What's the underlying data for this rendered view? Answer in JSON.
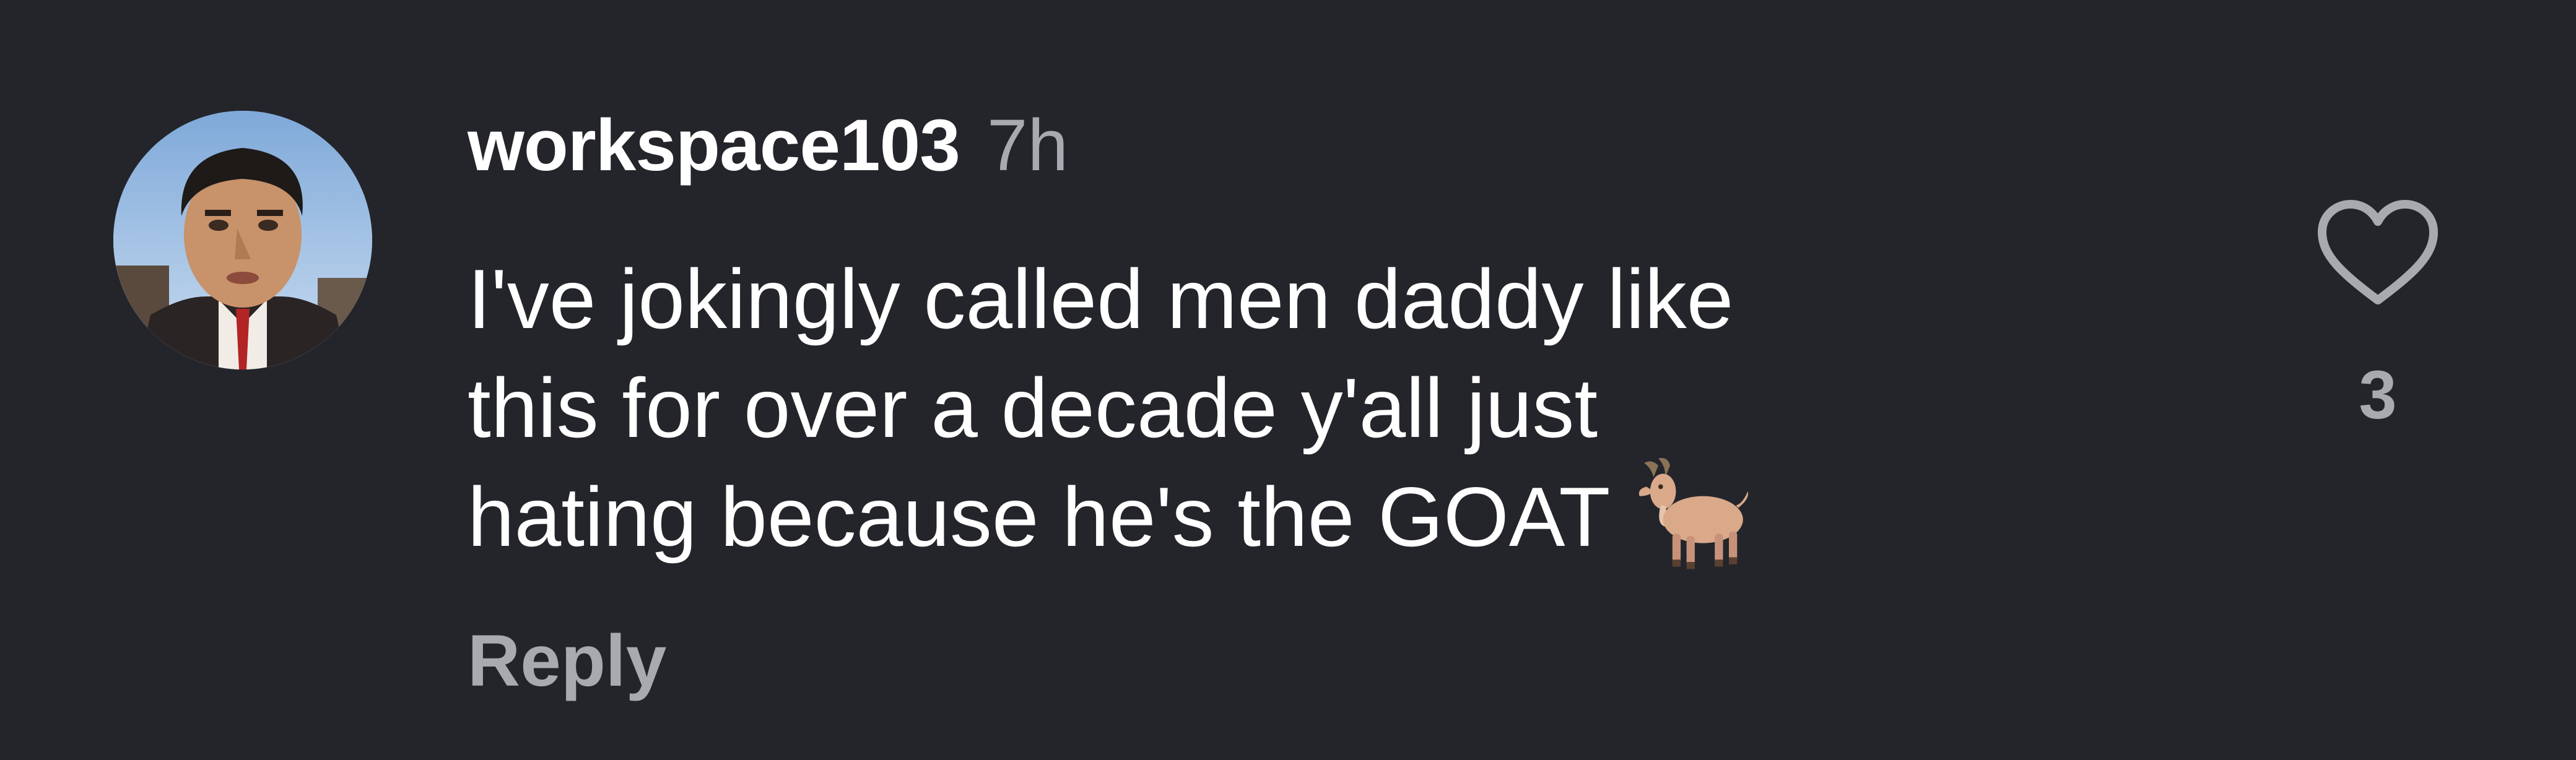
{
  "comment": {
    "username": "workspace103",
    "timestamp": "7h",
    "text_lines": [
      "I've jokingly called men daddy like",
      "this for over a decade y'all just",
      "hating because he's the GOAT"
    ],
    "emoji": "goat-icon",
    "reply_label": "Reply",
    "like_icon": "heart-icon",
    "like_count": "3"
  },
  "colors": {
    "background": "#23252b",
    "primary_text": "#ffffff",
    "secondary_text": "#a9aab0"
  }
}
